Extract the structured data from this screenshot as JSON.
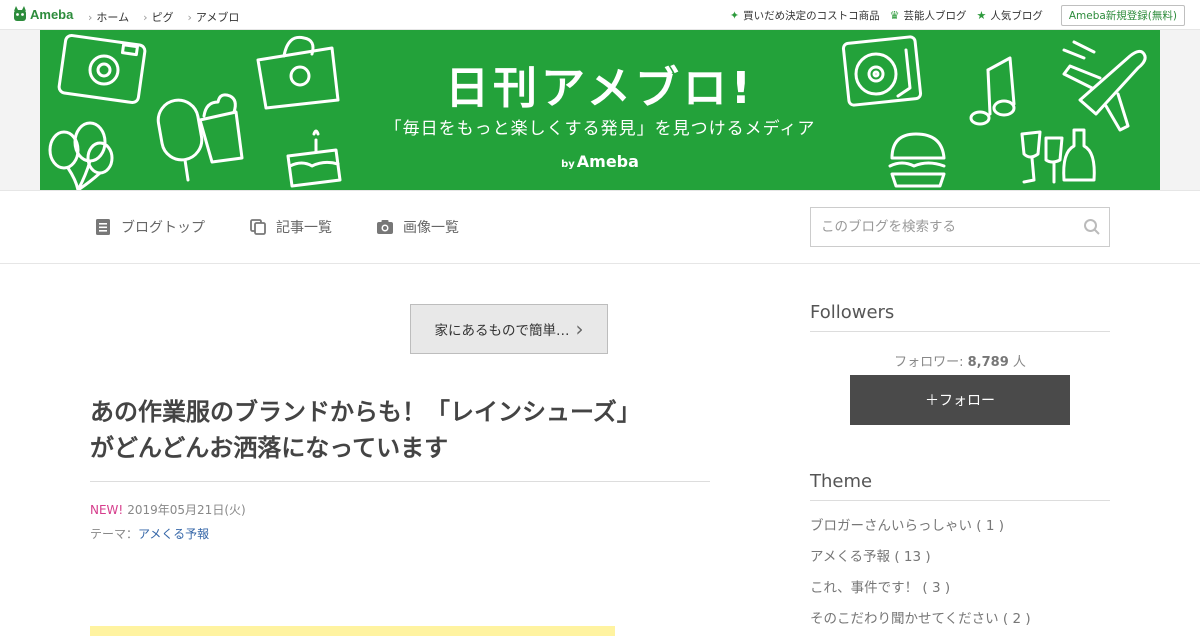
{
  "topbar": {
    "logo_text": "Ameba",
    "nav": [
      "ホーム",
      "ピグ",
      "アメブロ"
    ],
    "links": [
      {
        "icon": "sparkle-icon",
        "label": "買いだめ決定のコストコ商品"
      },
      {
        "icon": "crown-icon",
        "label": "芸能人ブログ"
      },
      {
        "icon": "star-icon",
        "label": "人気ブログ"
      }
    ],
    "register_label": "Ameba新規登録(無料)"
  },
  "banner": {
    "title": "日刊アメブロ!",
    "subtitle": "「毎日をもっと楽しくする発見」を見つけるメディア",
    "by": "by",
    "brand": "Ameba",
    "bg_color": "#23a23a"
  },
  "blognav": {
    "tabs": [
      {
        "icon": "document-icon",
        "label": "ブログトップ"
      },
      {
        "icon": "copy-icon",
        "label": "記事一覧"
      },
      {
        "icon": "camera-icon",
        "label": "画像一覧"
      }
    ],
    "search_placeholder": "このブログを検索する"
  },
  "entry": {
    "prev_label": "家にあるもので簡単…",
    "title_line1": "あの作業服のブランドからも！「レインシューズ」",
    "title_line2": "がどんどんお洒落になっています",
    "new_badge": "NEW!",
    "date": "2019年05月21日(火)",
    "theme_label": "テーマ：",
    "theme_value": "アメくる予報"
  },
  "sidebar": {
    "followers_heading": "Followers",
    "followers_label": "フォロワー:",
    "followers_count": "8,789",
    "followers_unit": "人",
    "follow_button": "＋フォロー",
    "theme_heading": "Theme",
    "themes": [
      "ブロガーさんいらっしゃい ( 1 )",
      "アメくる予報 ( 13 )",
      "これ、事件です！ ( 3 )",
      "そのこだわり聞かせてください ( 2 )"
    ]
  },
  "colors": {
    "accent_green": "#2d8c3c",
    "new_pink": "#d63d8c",
    "link_blue": "#3667a8",
    "follow_dark": "#4a4a4a"
  }
}
